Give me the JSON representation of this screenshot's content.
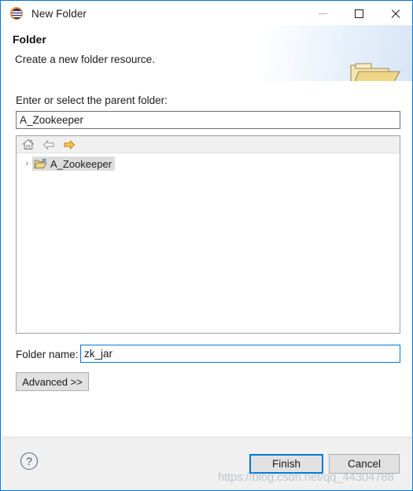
{
  "window": {
    "title": "New Folder",
    "app_icon": "eclipse-icon",
    "controls": {
      "minimize": "minimize-icon",
      "maximize": "maximize-icon",
      "close": "close-icon"
    },
    "border_color": "#0078d7"
  },
  "header": {
    "title": "Folder",
    "subtitle": "Create a new folder resource.",
    "banner_icon": "open-folder-icon"
  },
  "form": {
    "parent_label": "Enter or select the parent folder:",
    "parent_value": "A_Zookeeper",
    "parent_placeholder": "",
    "folder_name_label": "Folder name:",
    "folder_name_value": "zk_jar",
    "folder_name_placeholder": "",
    "advanced_label": "Advanced >>"
  },
  "tree": {
    "toolbar": [
      {
        "name": "home-icon",
        "label": "Home",
        "enabled": true
      },
      {
        "name": "back-arrow-icon",
        "label": "Back",
        "enabled": false
      },
      {
        "name": "forward-arrow-icon",
        "label": "Forward",
        "enabled": true
      }
    ],
    "items": [
      {
        "label": "A_Zookeeper",
        "expander": "›",
        "icon": "folder-icon",
        "selected": true,
        "expanded": false
      }
    ]
  },
  "footer": {
    "help_label": "?",
    "finish_label": "Finish",
    "cancel_label": "Cancel",
    "default_button": "Finish"
  },
  "watermark": {
    "text": "https://blog.csdn.net/qq_44304788"
  },
  "colors": {
    "accent": "#0078d7",
    "folder_gold": "#f2dda0",
    "selection": "#dcdcdc",
    "chrome": "#f0f0f0"
  }
}
